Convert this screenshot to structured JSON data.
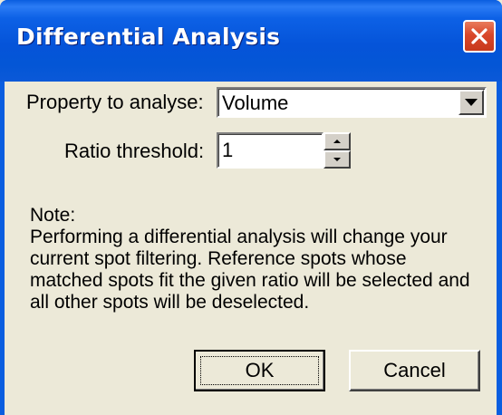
{
  "window": {
    "title": "Differential Analysis",
    "close_icon": "close-icon"
  },
  "form": {
    "property_label": "Property to analyse:",
    "property_value": "Volume",
    "ratio_label": "Ratio threshold:",
    "ratio_value": "1"
  },
  "note": {
    "heading": "Note:",
    "body": "Performing a differential analysis will change your current spot filtering. Reference spots whose matched spots fit the given ratio will be selected and all other spots will be deselected."
  },
  "buttons": {
    "ok_label": "OK",
    "cancel_label": "Cancel"
  },
  "colors": {
    "titlebar": "#0554d9",
    "close_button": "#d9472a",
    "dialog_face": "#ece9d8"
  }
}
